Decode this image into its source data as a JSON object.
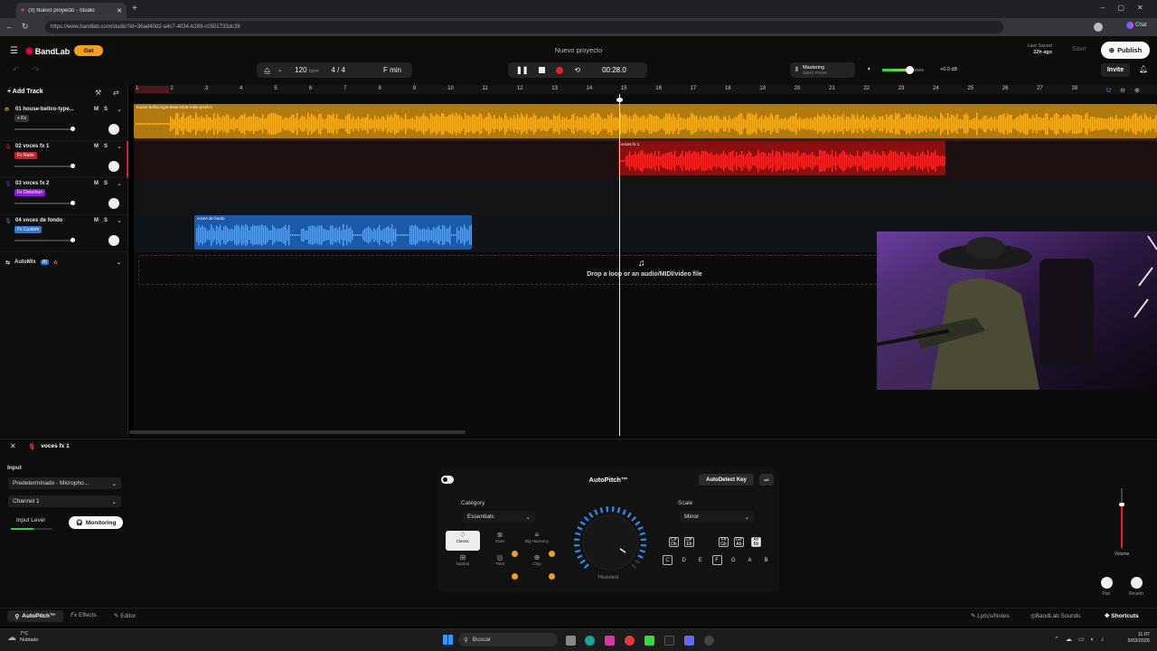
{
  "browser": {
    "tab_title": "(3) Nuevo proyecto - Studio",
    "url": "https://www.bandlab.com/studio?id=36ad40d2-a4c7-4034-b289-c0501733dc39",
    "chat_label": "Chat"
  },
  "header": {
    "logo": "BandLab",
    "get_label": "Get",
    "project_title": "Nuevo proyecto",
    "last_saved_label": "Last Saved",
    "last_saved_value": "22h ago",
    "save_label": "Save",
    "publish_label": "Publish",
    "invite_label": "Invite"
  },
  "transport": {
    "bpm": "120",
    "bpm_unit": "bpm",
    "time_sig": "4 / 4",
    "key": "F min",
    "time": "00:28.0",
    "mastering_label": "Mastering",
    "mastering_sub": "Select Preset",
    "master_db": "+0.0 dB"
  },
  "add_track_label": "Add Track",
  "ruler": [
    "1",
    "2",
    "3",
    "4",
    "5",
    "6",
    "7",
    "8",
    "9",
    "10",
    "11",
    "12",
    "13",
    "14",
    "15",
    "16",
    "17",
    "18",
    "19",
    "20",
    "21",
    "22",
    "23",
    "24",
    "25",
    "26",
    "27",
    "28"
  ],
  "tracks": [
    {
      "name": "01  house-bellco-type...",
      "fx": "+ Fx",
      "fx_color": "#333333",
      "m": "M",
      "s": "S"
    },
    {
      "name": "02  voces fx 1",
      "fx": "Fx Ratio",
      "fx_color": "#c4222a",
      "m": "M",
      "s": "S"
    },
    {
      "name": "03  voces fx 2",
      "fx": "Fx Distortion",
      "fx_color": "#8a1fd0",
      "m": "M",
      "s": "S"
    },
    {
      "name": "04  voces de fondo",
      "fx": "Fx Custom",
      "fx_color": "#2b78d8",
      "m": "M",
      "s": "S"
    }
  ],
  "automix": {
    "label": "AutoMix",
    "badge": "AI"
  },
  "clips": {
    "clip1": "house-bellco-type-beat-2025-rolex-prod.m",
    "clip2": "voces fx 1",
    "clip3": "voces de fondo"
  },
  "drop_text": "Drop a loop or an audio/MIDI/video file",
  "panel": {
    "track_name": "voces fx 1",
    "input_label": "Input",
    "input_device": "Predeterminado - Micropho...",
    "channel": "Channel 1",
    "input_level_label": "Input Level",
    "monitoring_label": "Monitoring",
    "autopitch_title": "AutoPitch™",
    "autodetect_label": "AutoDetect Key",
    "category_label": "Category",
    "category_value": "Essentials",
    "scale_label": "Scale",
    "scale_value": "Minor",
    "dial_label": "Heaviest",
    "presets": [
      "Classic",
      "Duet",
      "Big Harmony",
      "Natural",
      "Third",
      "Chip"
    ],
    "accidentals": [
      "C#\nDb",
      "D#\nEb",
      "F#\nGb",
      "G#\nAb",
      "A#\nBb"
    ],
    "notes": [
      "C",
      "D",
      "E",
      "F",
      "G",
      "A",
      "B"
    ],
    "volume_label": "Volume",
    "pan_label": "Pan",
    "reverb_label": "Reverb"
  },
  "footer": {
    "autopitch_tab": "AutoPitch™",
    "effects_tab": "Effects",
    "editor_tab": "Editor",
    "lyrics_label": "Lyrics/Notes",
    "sounds_label": "BandLab Sounds",
    "shortcuts_label": "Shortcuts"
  },
  "taskbar": {
    "weather_temp": "7°C",
    "weather_desc": "Nublado",
    "search": "Buscar",
    "time": "11:07",
    "date": "5/03/2026"
  },
  "colors": {
    "track1": "#e0a21a",
    "track2": "#d81e1e",
    "track4": "#2f86e0",
    "accent": "#f0a020"
  }
}
